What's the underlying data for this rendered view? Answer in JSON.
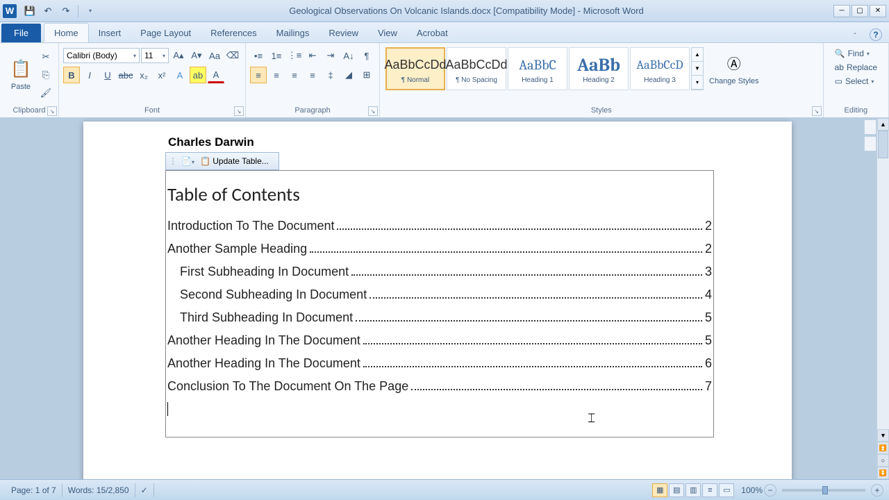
{
  "title": "Geological Observations On Volcanic Islands.docx [Compatibility Mode] - Microsoft Word",
  "tabs": {
    "file": "File",
    "home": "Home",
    "insert": "Insert",
    "page_layout": "Page Layout",
    "references": "References",
    "mailings": "Mailings",
    "review": "Review",
    "view": "View",
    "acrobat": "Acrobat"
  },
  "clipboard": {
    "paste": "Paste",
    "label": "Clipboard"
  },
  "font": {
    "name": "Calibri (Body)",
    "size": "11",
    "label": "Font"
  },
  "paragraph": {
    "label": "Paragraph"
  },
  "styles": {
    "label": "Styles",
    "items": [
      {
        "preview": "AaBbCcDd",
        "name": "¶ Normal"
      },
      {
        "preview": "AaBbCcDd",
        "name": "¶ No Spacing"
      },
      {
        "preview": "AaBbC",
        "name": "Heading 1"
      },
      {
        "preview": "AaBb",
        "name": "Heading 2"
      },
      {
        "preview": "AaBbCcD",
        "name": "Heading 3"
      }
    ],
    "change": "Change Styles"
  },
  "editing": {
    "find": "Find",
    "replace": "Replace",
    "select": "Select",
    "label": "Editing"
  },
  "document": {
    "author": "Charles Darwin",
    "update_table": "Update Table...",
    "toc_title": "Table of Contents",
    "toc": [
      {
        "text": "Introduction To The Document",
        "page": "2",
        "level": 1
      },
      {
        "text": "Another Sample Heading",
        "page": "2",
        "level": 1
      },
      {
        "text": "First Subheading In Document",
        "page": "3",
        "level": 2
      },
      {
        "text": "Second Subheading In Document",
        "page": "4",
        "level": 2
      },
      {
        "text": "Third Subheading In Document",
        "page": "5",
        "level": 2
      },
      {
        "text": "Another Heading In The Document",
        "page": "5",
        "level": 1
      },
      {
        "text": "Another Heading In The Document",
        "page": "6",
        "level": 1
      },
      {
        "text": "Conclusion To The Document On The Page",
        "page": "7",
        "level": 1
      }
    ]
  },
  "status": {
    "page": "Page: 1 of 7",
    "words": "Words: 15/2,850",
    "zoom": "100%"
  }
}
